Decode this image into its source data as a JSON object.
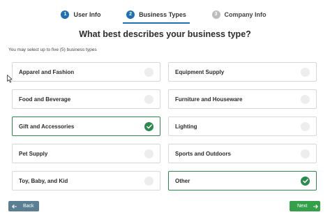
{
  "stepper": {
    "steps": [
      {
        "number": "1",
        "label": "User Info",
        "state": "done"
      },
      {
        "number": "2",
        "label": "Business Types",
        "state": "active"
      },
      {
        "number": "3",
        "label": "Company Info",
        "state": "todo"
      }
    ]
  },
  "page": {
    "title": "What best describes your business type?",
    "subtitle": "You may select up to five (5) business types"
  },
  "options": [
    {
      "label": "Apparel and Fashion",
      "selected": false
    },
    {
      "label": "Equipment Supply",
      "selected": false
    },
    {
      "label": "Food and Beverage",
      "selected": false
    },
    {
      "label": "Furniture and Houseware",
      "selected": false
    },
    {
      "label": "Gift and Accessories",
      "selected": true
    },
    {
      "label": "Lighting",
      "selected": false
    },
    {
      "label": "Pet Supply",
      "selected": false
    },
    {
      "label": "Sports and Outdoors",
      "selected": false
    },
    {
      "label": "Toy, Baby, and Kid",
      "selected": false
    },
    {
      "label": "Other",
      "selected": true
    }
  ],
  "footer": {
    "back_label": "Back",
    "next_label": "Next"
  },
  "colors": {
    "primary_blue": "#1f6fb2",
    "selected_green": "#2d8a4e",
    "next_green": "#35a04a",
    "back_slate": "#5b7f92"
  },
  "icons": {
    "back": "arrow-left-icon",
    "next": "arrow-right-icon",
    "check": "check-icon"
  }
}
